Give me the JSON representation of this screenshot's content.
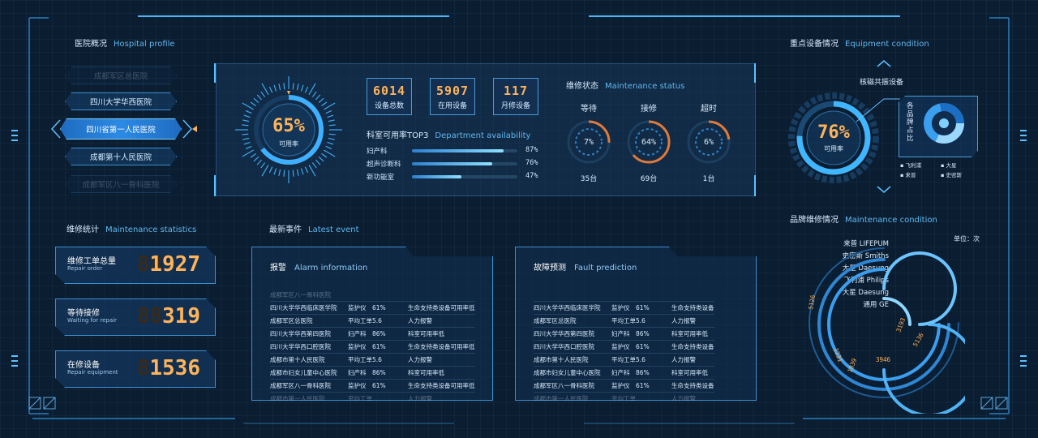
{
  "hospital_profile": {
    "title_cn": "医院概况",
    "title_en": "Hospital profile",
    "hospitals": [
      {
        "name": "成都军区总医院"
      },
      {
        "name": "四川大学华西医院"
      },
      {
        "name": "四川省第一人民医院"
      },
      {
        "name": "成都第十人民医院"
      },
      {
        "name": "成都军区八一骨科医院"
      }
    ]
  },
  "availability": {
    "value": "65%",
    "label": "可用率"
  },
  "stats": [
    {
      "value": "6014",
      "label": "设备总数"
    },
    {
      "value": "5907",
      "label": "在用设备"
    },
    {
      "value": "117",
      "label": "月修设备"
    }
  ],
  "dept": {
    "title_cn": "科室可用率TOP3",
    "title_en": "Department availability",
    "rows": [
      {
        "name": "妇产科",
        "pct": "87%",
        "value": 0.87
      },
      {
        "name": "超声诊断科",
        "pct": "76%",
        "value": 0.76
      },
      {
        "name": "新功能室",
        "pct": "47%",
        "value": 0.47
      }
    ]
  },
  "maintenance_status": {
    "title_cn": "维修状态",
    "title_en": "Maintenance status",
    "items": [
      {
        "label": "等待",
        "pct": "7%",
        "count": "35台"
      },
      {
        "label": "接修",
        "pct": "64%",
        "count": "69台"
      },
      {
        "label": "超时",
        "pct": "6%",
        "count": "1台"
      }
    ]
  },
  "equipment": {
    "title_cn": "重点设备情况",
    "title_en": "Equipment condition",
    "device_name": "核磁共振设备",
    "availability": "76%",
    "availability_label": "可用率",
    "share_label": "各品牌占比",
    "legend": [
      "飞利浦",
      "大星",
      "来普",
      "史密斯"
    ]
  },
  "maintenance_stats": {
    "title_cn": "维修统计",
    "title_en": "Maintenance statistics",
    "items": [
      {
        "cn": "维修工单总量",
        "en": "Repair order",
        "value": "1927",
        "dim": "88"
      },
      {
        "cn": "等待接修",
        "en": "Waiting for repair",
        "value": "319",
        "dim": "88"
      },
      {
        "cn": "在修设备",
        "en": "Repair equipment",
        "value": "1536",
        "dim": "8"
      }
    ]
  },
  "latest_event": {
    "title_cn": "最新事件",
    "title_en": "Latest event"
  },
  "alarm": {
    "title_cn": "报警",
    "title_en": "Alarm information",
    "rows": [
      [
        "成都军区八一骨科医院",
        "",
        "",
        ""
      ],
      [
        "四川大学华西临床医学院",
        "监护仪",
        "61%",
        "生命支持类设备可用率低"
      ],
      [
        "成都军区总医院",
        "平均工单",
        "5.6",
        "人力报警"
      ],
      [
        "四川大学华西第四医院",
        "妇产科",
        "86%",
        "科室可用率低"
      ],
      [
        "四川大学华西口腔医院",
        "监护仪",
        "61%",
        "生命支持类设备可用率低"
      ],
      [
        "成都市第十人民医院",
        "平均工单",
        "5.6",
        "人力报警"
      ],
      [
        "成都市妇女儿童中心医院",
        "妇产科",
        "86%",
        "科室可用率低"
      ],
      [
        "成都军区八一骨科医院",
        "监护仪",
        "61%",
        "生命支持类设备可用率低"
      ],
      [
        "成都市第一人民医院",
        "平均工单",
        "",
        "人力报警"
      ]
    ]
  },
  "fault": {
    "title_cn": "故障预测",
    "title_en": "Fault prediction",
    "rows": [
      [
        "",
        "",
        "",
        ""
      ],
      [
        "四川大学华西临床医学院",
        "监护仪",
        "61%",
        "生命支持类设备"
      ],
      [
        "成都军区总医院",
        "平均工单",
        "5.6",
        "人力报警"
      ],
      [
        "四川大学华西第四医院",
        "妇产科",
        "86%",
        "科室可用率低"
      ],
      [
        "四川大学华西口腔医院",
        "监护仪",
        "61%",
        "生命支持类设备"
      ],
      [
        "成都市第十人民医院",
        "平均工单",
        "5.6",
        "人力报警"
      ],
      [
        "成都市妇女儿童中心医院",
        "妇产科",
        "86%",
        "科室可用率低"
      ],
      [
        "成都军区八一骨科医院",
        "监护仪",
        "61%",
        "生命支持类设备"
      ],
      [
        "成都市第一人民医院",
        "平均工单",
        "",
        "人力报警"
      ]
    ]
  },
  "brand": {
    "title_cn": "品牌维修情况",
    "title_en": "Maintenance condition",
    "unit": "单位：次",
    "brands": [
      "来普 LIFEPUM",
      "史密斯 Smiths",
      "大星 Daesung",
      "飞利浦 Philips",
      "大星 Daesung",
      "通用 GE"
    ],
    "values": [
      "5126",
      "3946",
      "1839",
      "1231",
      "3193",
      "5136"
    ]
  },
  "colors": {
    "accent": "#2f9cf0",
    "orange": "#ffb35a",
    "panel": "#0b1d30"
  }
}
